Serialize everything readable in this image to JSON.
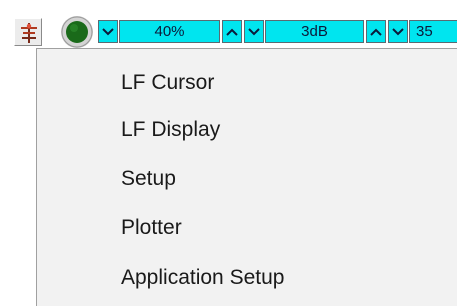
{
  "toolbar": {
    "tool_icon": "antenna-bug-icon",
    "status_led_icon": "status-led-icon",
    "status_led_color": "#1a6a1a",
    "controls": [
      {
        "value": "40%"
      },
      {
        "value": "3dB"
      },
      {
        "value": "35"
      }
    ],
    "accent_color": "#00e5ef"
  },
  "menu": {
    "items": [
      {
        "label": "LF Cursor"
      },
      {
        "label": "LF Display"
      },
      {
        "label": "Setup"
      },
      {
        "label": "Plotter"
      },
      {
        "label": "Application Setup"
      }
    ]
  }
}
